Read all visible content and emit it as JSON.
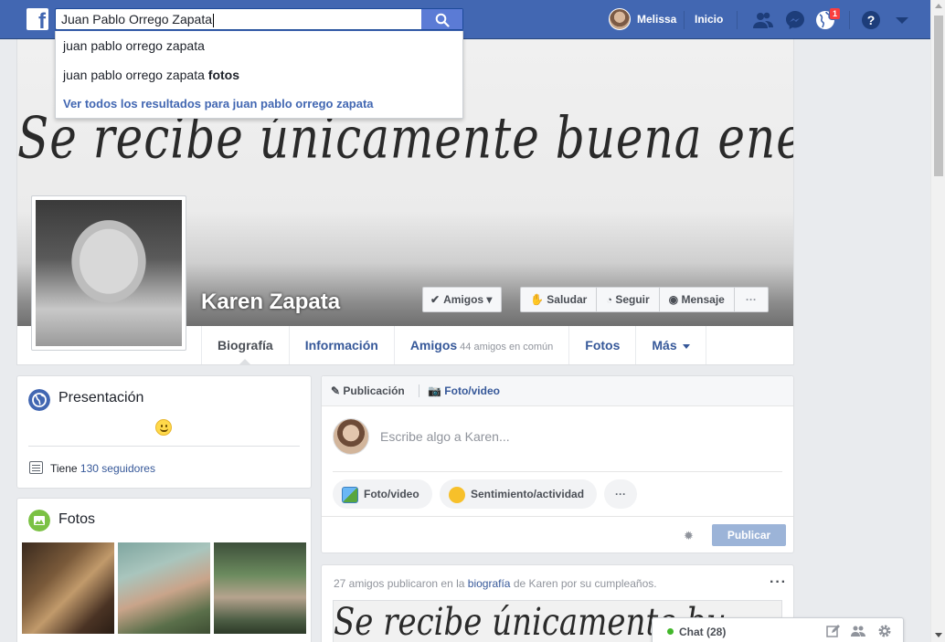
{
  "topbar": {
    "logo": "f",
    "search_value": "Juan Pablo Orrego Zapata",
    "search_icon": "search-icon",
    "user_name": "Melissa",
    "home_label": "Inicio",
    "notification_count": "1",
    "brand_color": "#4267b2"
  },
  "search_dropdown": {
    "suggestion_1": "juan pablo orrego zapata",
    "suggestion_2_prefix": "juan pablo orrego zapata",
    "suggestion_2_bold": "fotos",
    "see_all": "Ver todos los resultados para juan pablo orrego zapata"
  },
  "profile": {
    "cover_text": "Se  recibe únicamente buena energía",
    "name": "Karen Zapata",
    "friends_button": "Amigos",
    "wave_button": "Saludar",
    "follow_button": "Seguir",
    "message_button": "Mensaje",
    "more_button": "···"
  },
  "tabs": [
    {
      "label": "Biografía"
    },
    {
      "label": "Información"
    },
    {
      "label": "Amigos",
      "sub": "44 amigos en común"
    },
    {
      "label": "Fotos"
    },
    {
      "label": "Más"
    }
  ],
  "intro": {
    "title": "Presentación",
    "followers_prefix": "Tiene",
    "followers_link": "130 seguidores"
  },
  "photos": {
    "title": "Fotos"
  },
  "composer": {
    "tab_post": "Publicación",
    "tab_photo": "Foto/video",
    "placeholder": "Escribe algo a Karen...",
    "photo_video": "Foto/video",
    "feeling": "Sentimiento/actividad",
    "more": "···",
    "publish": "Publicar"
  },
  "birthday_post": {
    "text_1": "27 amigos publicaron en la",
    "link": "biografía",
    "text_2": "de Karen por su cumpleaños.",
    "more": "···",
    "image_text": "Se  recibe únicamente bu"
  },
  "chat": {
    "label": "Chat (28)"
  }
}
